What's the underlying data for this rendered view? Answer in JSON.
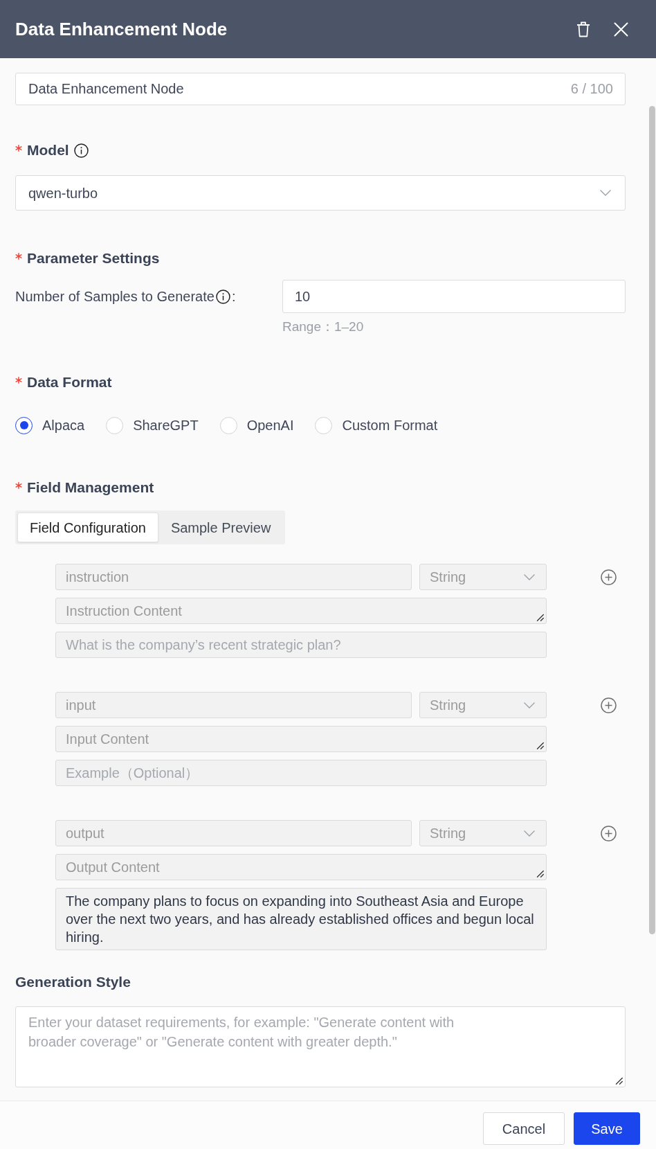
{
  "panel": {
    "title": "Data Enhancement Node"
  },
  "name_field": {
    "value": "Data Enhancement Node",
    "counter": "6 / 100"
  },
  "model": {
    "label": "Model",
    "required": true,
    "value": "qwen-turbo"
  },
  "parameter_settings": {
    "label": "Parameter Settings",
    "required": true,
    "samples": {
      "label": "Number of Samples to Generate",
      "colon": ":",
      "value": "10",
      "hint": "Range：1–20"
    }
  },
  "data_format": {
    "label": "Data Format",
    "required": true,
    "options": [
      {
        "label": "Alpaca",
        "selected": true
      },
      {
        "label": "ShareGPT",
        "selected": false
      },
      {
        "label": "OpenAI",
        "selected": false
      },
      {
        "label": "Custom Format",
        "selected": false
      }
    ]
  },
  "field_management": {
    "label": "Field Management",
    "required": true,
    "tabs": [
      {
        "label": "Field Configuration",
        "selected": true
      },
      {
        "label": "Sample Preview",
        "selected": false
      }
    ],
    "fields": [
      {
        "name": {
          "value": "instruction",
          "disabled": true
        },
        "type": {
          "value": "String",
          "disabled": true
        },
        "description": {
          "value": "Instruction Content",
          "disabled": true
        },
        "example": {
          "placeholder": "What is the company’s recent strategic plan?"
        }
      },
      {
        "name": {
          "value": "input",
          "disabled": true
        },
        "type": {
          "value": "String",
          "disabled": true
        },
        "description": {
          "value": "Input Content",
          "disabled": true
        },
        "example": {
          "placeholder": "Example（Optional）"
        }
      },
      {
        "name": {
          "value": "output",
          "disabled": true
        },
        "type": {
          "value": "String",
          "disabled": true
        },
        "description": {
          "value": "Output Content",
          "disabled": true
        },
        "example": {
          "value": "The company plans to focus on expanding into Southeast Asia and Europe over the next two years, and has already established offices and begun local hiring."
        }
      }
    ]
  },
  "generation_style": {
    "label": "Generation Style",
    "required": false,
    "placeholder": "Enter your dataset requirements, for example: \"Generate content with broader coverage\" or \"Generate content with greater depth.\""
  },
  "footer": {
    "buttons": [
      {
        "label": "Cancel",
        "kind": "secondary"
      },
      {
        "label": "Save",
        "kind": "primary"
      }
    ]
  }
}
